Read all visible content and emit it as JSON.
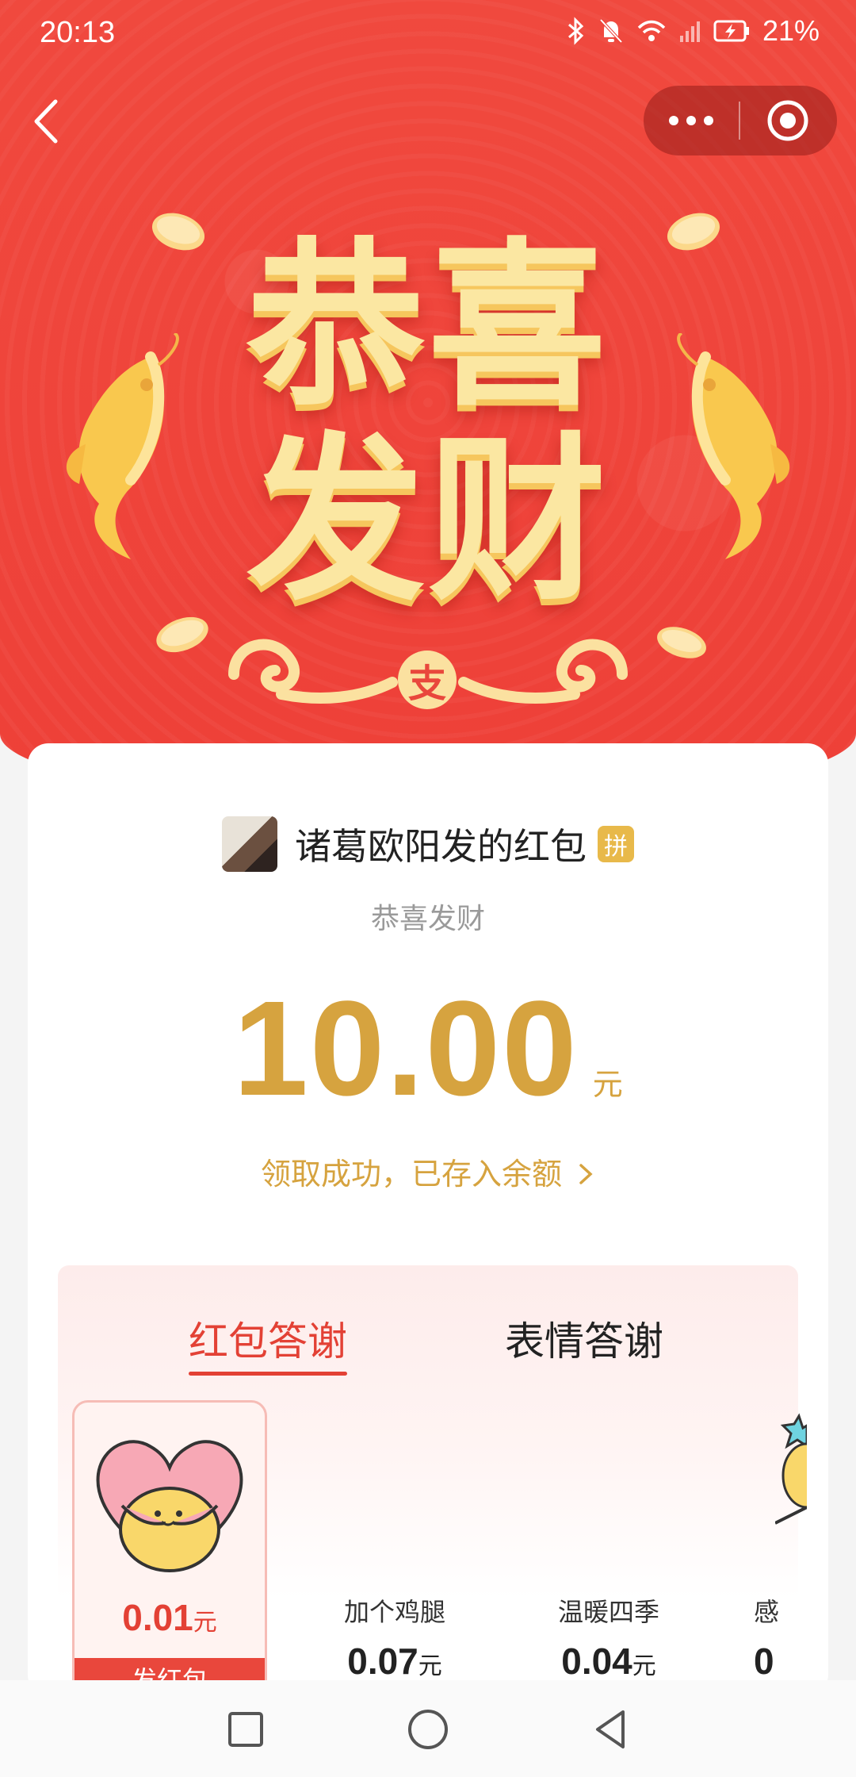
{
  "status_bar": {
    "time": "20:13",
    "battery_percent": "21%",
    "icons": [
      "bluetooth-icon",
      "mute-bell-icon",
      "wifi-icon",
      "signal-icon",
      "battery-charging-icon"
    ]
  },
  "top_bar": {
    "back_icon": "chevron-left-icon",
    "more_icon": "more-dots-icon",
    "close_icon": "target-circle-icon"
  },
  "hero": {
    "headline_line1": "恭喜",
    "headline_line2": "发财",
    "badge_char": "支",
    "colors": {
      "red": "#ee4038",
      "gold": "#fbe7a2"
    }
  },
  "card": {
    "sender_name": "诸葛欧阳发的红包",
    "pin_badge": "拼",
    "blessing": "恭喜发财",
    "amount": "10.00",
    "amount_unit": "元",
    "received_text": "领取成功，已存入余额",
    "accent_color": "#d6a33f"
  },
  "thanks": {
    "tabs": [
      {
        "label": "红包答谢",
        "active": true
      },
      {
        "label": "表情答谢",
        "active": false
      }
    ],
    "selected_gift": {
      "price": "0.01",
      "unit": "元",
      "send_label": "发红包"
    },
    "gifts": [
      {
        "name": "加个鸡腿",
        "price": "0.07",
        "unit": "元"
      },
      {
        "name": "温暖四季",
        "price": "0.04",
        "unit": "元"
      },
      {
        "name": "感",
        "price": "0",
        "unit": ""
      }
    ]
  },
  "nav_bar": {
    "icons": [
      "recent-apps-icon",
      "home-icon",
      "back-triangle-icon"
    ]
  }
}
